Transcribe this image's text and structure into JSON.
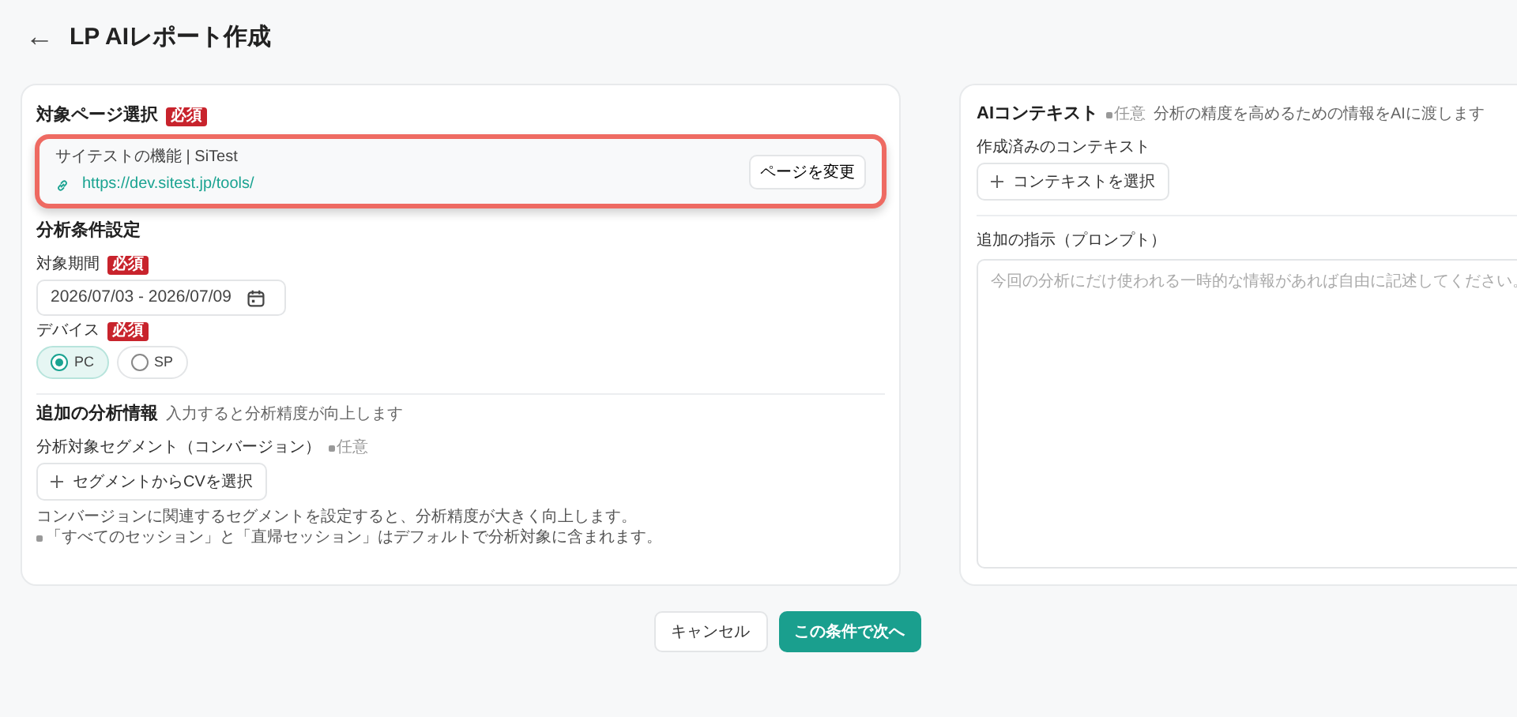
{
  "header": {
    "back_icon": "←",
    "title": "LP AIレポート作成"
  },
  "target_page": {
    "title": "対象ページ選択",
    "badge": "必須",
    "highlighted": true,
    "page_name": "サイテストの機能 | SiTest",
    "url": "https://dev.sitest.jp/tools/",
    "change_button": "ページを変更"
  },
  "conditions": {
    "title": "分析条件設定",
    "period_label": "対象期間",
    "period_badge": "必須",
    "period_value": "2026/07/03 - 2026/07/09",
    "device_label": "デバイス",
    "device_badge": "必須",
    "devices": [
      {
        "label": "PC",
        "selected": true
      },
      {
        "label": "SP",
        "selected": false
      }
    ]
  },
  "additional": {
    "title": "追加の分析情報",
    "hint": "入力すると分析精度が向上します",
    "segment_label": "分析対象セグメント（コンバージョン）",
    "segment_optional": "任意",
    "segment_button": "セグメントからCVを選択",
    "note_1": "コンバージョンに関連するセグメントを設定すると、分析精度が大きく向上します。",
    "note_2": "「すべてのセッション」と「直帰セッション」はデフォルトで分析対象に含まれます。"
  },
  "ai_context": {
    "title": "AIコンテキスト",
    "optional": "任意",
    "hint": "分析の精度を高めるための情報をAIに渡します",
    "context_label": "作成済みのコンテキスト",
    "context_button": "コンテキストを選択",
    "prompt_label": "追加の指示（プロンプト）",
    "prompt_placeholder": "今回の分析にだけ使われる一時的な情報があれば自由に記述してください。"
  },
  "footer": {
    "cancel": "キャンセル",
    "next": "この条件で次へ"
  }
}
